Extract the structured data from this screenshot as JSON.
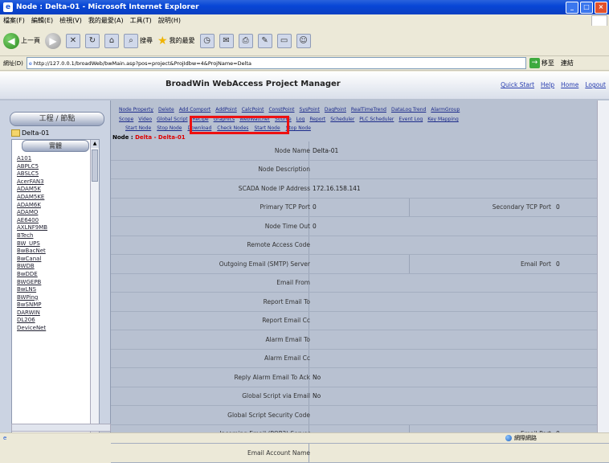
{
  "window": {
    "title": "Node : Delta-01 - Microsoft Internet Explorer"
  },
  "menubar": {
    "items": [
      "檔案(F)",
      "編輯(E)",
      "檢視(V)",
      "我的最愛(A)",
      "工具(T)",
      "說明(H)"
    ]
  },
  "toolbar": {
    "back_label": "上一頁",
    "search_label": "搜尋",
    "favorites_label": "我的最愛"
  },
  "address": {
    "label": "網址(D)",
    "url": "http://127.0.0.1/broadWeb/bwMain.asp?pos=project&ProjIdbw=4&ProjName=Delta",
    "go_label": "移至",
    "links_label": "連結"
  },
  "page": {
    "title": "BroadWin WebAccess Project Manager",
    "top_links": [
      "Quick Start",
      "Help",
      "Home",
      "Logout"
    ]
  },
  "left_panel": {
    "header": "工程 / 節點",
    "root_node": "Delta-01",
    "tree_header": "實體",
    "items": [
      "A101",
      "ABPLC5",
      "ABSLC5",
      "AcerFAN3",
      "ADAM5K",
      "ADAM5KE",
      "ADAM6K",
      "ADAMO",
      "AE6400",
      "AXLNF9MB",
      "BTech",
      "BW_UPS",
      "BwBacNet",
      "BwCanal",
      "BWDB",
      "BwDDE",
      "BWGEPB",
      "BwLNS",
      "BWPing",
      "BwSNMP",
      "DARWIN",
      "DL206",
      "DeviceNet"
    ]
  },
  "nav": {
    "row1": [
      "Node Property",
      "Delete",
      "Add Comport",
      "AddPoint",
      "CalcPoint",
      "ConstPoint",
      "SysPoint",
      "DaqPoint",
      "RealTimeTrend",
      "DataLog Trend",
      "AlarmGroup"
    ],
    "row2": [
      "Scope",
      "Video",
      "Global Script",
      "Recipe",
      "Graphics",
      "WebWatcher",
      "Source",
      "Log",
      "Report",
      "Scheduler",
      "PLC Scheduler",
      "Event Log",
      "Key Mapping"
    ],
    "sub": [
      "Start Node",
      "Stop Node",
      "Download",
      "Check Nodes",
      "Start Node",
      "Stop Node"
    ]
  },
  "node_line": {
    "label": "Node :",
    "value": "Delta - Delta-01"
  },
  "fields": [
    {
      "label": "Node Name",
      "value": "Delta-01"
    },
    {
      "label": "Node Description",
      "value": ""
    },
    {
      "label": "SCADA Node IP Address",
      "value": "172.16.158.141"
    },
    {
      "label": "Primary TCP Port",
      "value": "0",
      "label2": "Secondary TCP Port",
      "value2": "0"
    },
    {
      "label": "Node Time Out",
      "value": "0"
    },
    {
      "label": "Remote Access Code",
      "value": ""
    },
    {
      "label": "Outgoing Email (SMTP) Server",
      "value": "",
      "label2": "Email Port",
      "value2": "0"
    },
    {
      "label": "Email From",
      "value": ""
    },
    {
      "label": "Report Email To",
      "value": ""
    },
    {
      "label": "Report Email Cc",
      "value": ""
    },
    {
      "label": "Alarm Email To",
      "value": ""
    },
    {
      "label": "Alarm Email Cc",
      "value": ""
    },
    {
      "label": "Reply Alarm Email To Ack",
      "value": "No"
    },
    {
      "label": "Global Script via Email",
      "value": "No"
    },
    {
      "label": "Global Script Security Code",
      "value": ""
    },
    {
      "label": "Incoming Email (POP3) Server",
      "value": "",
      "label2": "Email Port",
      "value2": "0"
    },
    {
      "label": "Email Account Name",
      "value": ""
    }
  ],
  "status": {
    "zone": "網際網路"
  }
}
